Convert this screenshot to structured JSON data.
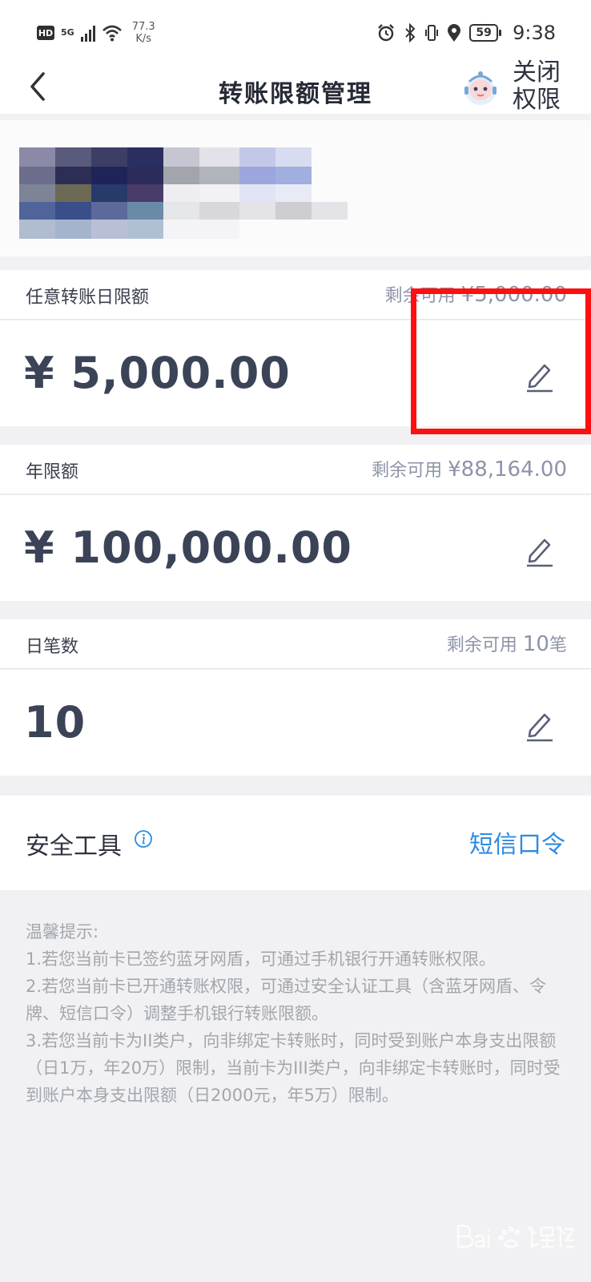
{
  "status_bar": {
    "hd": "HD",
    "network": "5G",
    "speed_value": "77.3",
    "speed_unit": "K/s",
    "battery": "59",
    "time": "9:38"
  },
  "nav": {
    "title": "转账限额管理",
    "close_line1": "关闭",
    "close_line2": "权限"
  },
  "limits": [
    {
      "label": "任意转账日限额",
      "remain_prefix": "剩余可用",
      "remain_value": "¥5,000.00",
      "amount": "¥ 5,000.00"
    },
    {
      "label": "年限额",
      "remain_prefix": "剩余可用",
      "remain_value": "¥88,164.00",
      "amount": "¥ 100,000.00"
    },
    {
      "label": "日笔数",
      "remain_prefix": "剩余可用",
      "remain_value": "10",
      "remain_suffix": "笔",
      "amount": "10"
    }
  ],
  "security": {
    "label": "安全工具",
    "value": "短信口令"
  },
  "tips": {
    "title": "温馨提示:",
    "items": [
      "1.若您当前卡已签约蓝牙网盾，可通过手机银行开通转账权限。",
      "2.若您当前卡已开通转账权限，可通过安全认证工具（含蓝牙网盾、令牌、短信口令）调整手机银行转账限额。",
      "3.若您当前卡为II类户，向非绑定卡转账时，同时受到账户本身支出限额（日1万，年20万）限制，当前卡为III类户，向非绑定卡转账时，同时受到账户本身支出限额（日2000元，年5万）限制。"
    ]
  },
  "watermark": "Baidu经验",
  "colors": {
    "accent_blue": "#2e8be0",
    "highlight_red": "#fe1010",
    "amount_text": "#3b4357",
    "muted_text": "#8c94a8"
  }
}
